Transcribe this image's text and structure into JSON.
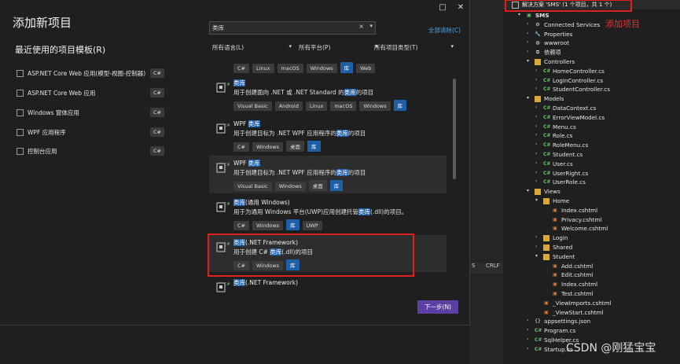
{
  "dialog": {
    "title": "添加新项目",
    "recent_title": "最近使用的项目模板(R)",
    "window_restore": "□",
    "window_close": "✕",
    "recent_templates": [
      {
        "label": "ASP.NET Core Web 应用(模型-视图-控制器)",
        "tag": "C#"
      },
      {
        "label": "ASP.NET Core Web 应用",
        "tag": "C#"
      },
      {
        "label": "Windows 窗体应用",
        "tag": "C#"
      },
      {
        "label": "WPF 应用程序",
        "tag": "C#"
      },
      {
        "label": "控制台应用",
        "tag": "C#"
      }
    ],
    "search": {
      "value": "类库",
      "clear": "×",
      "dropdown": "▾"
    },
    "clear_all": "全部清除(C)",
    "filters": [
      {
        "label": "所有语言(L)",
        "arrow": "▾"
      },
      {
        "label": "所有平台(P)",
        "arrow": "▾"
      },
      {
        "label": "所有项目类型(T)",
        "arrow": "▾"
      }
    ],
    "results": [
      {
        "name_pre": "",
        "name_hl": "",
        "name_post": "",
        "desc_pre": "",
        "desc_hl": "",
        "desc_post": "",
        "chips": [
          "C#",
          "Linux",
          "macOS",
          "Windows",
          "库",
          "Web"
        ]
      },
      {
        "name_pre": "",
        "name_hl": "类库",
        "name_post": "",
        "desc_pre": "用于创建面向 .NET 或 .NET Standard 的",
        "desc_hl": "类库",
        "desc_post": "的项目",
        "chips": [
          "Visual Basic",
          "Android",
          "Linux",
          "macOS",
          "Windows",
          "库"
        ]
      },
      {
        "name_pre": "WPF ",
        "name_hl": "类库",
        "name_post": "",
        "desc_pre": "用于创建目标为 .NET WPF 应用程序的",
        "desc_hl": "类库",
        "desc_post": "的项目",
        "chips": [
          "C#",
          "Windows",
          "桌面",
          "库"
        ]
      },
      {
        "name_pre": "WPF ",
        "name_hl": "类库",
        "name_post": "",
        "desc_pre": "用于创建目标为 .NET WPF 应用程序的",
        "desc_hl": "类库",
        "desc_post": "的项目",
        "chips": [
          "Visual Basic",
          "Windows",
          "桌面",
          "库"
        ]
      },
      {
        "name_pre": "",
        "name_hl": "类库",
        "name_post": "(通用 Windows)",
        "desc_pre": "用于为通用 Windows 平台(UWP)应用创建托管",
        "desc_hl": "类库",
        "desc_post": "(.dll)的项目。",
        "chips": [
          "C#",
          "Windows",
          "库",
          "UWP"
        ]
      },
      {
        "name_pre": "",
        "name_hl": "类库",
        "name_post": "(.NET Framework)",
        "desc_pre": "用于创建 C# ",
        "desc_hl": "类库",
        "desc_post": "(.dll)的项目",
        "chips": [
          "C#",
          "Windows",
          "库"
        ]
      },
      {
        "name_pre": "",
        "name_hl": "类库",
        "name_post": "(.NET Framework)",
        "desc_pre": "",
        "desc_hl": "",
        "desc_post": "",
        "chips": []
      }
    ],
    "next_button": "下一步(N)"
  },
  "background": {
    "status_left": "S",
    "status_right": "CRLF"
  },
  "solution_explorer": {
    "header": "解决方案 'SMS' (1 个项目，共 1 个)",
    "annotation": "添加项目",
    "tree": [
      {
        "label": "SMS",
        "kind": "project",
        "depth": 0,
        "exp": "▾"
      },
      {
        "label": "Connected Services",
        "kind": "service",
        "depth": 1,
        "exp": "›"
      },
      {
        "label": "Properties",
        "kind": "props",
        "depth": 1,
        "exp": "›"
      },
      {
        "label": "wwwroot",
        "kind": "web",
        "depth": 1,
        "exp": "›"
      },
      {
        "label": "依赖项",
        "kind": "deps",
        "depth": 1,
        "exp": "›"
      },
      {
        "label": "Controllers",
        "kind": "folder",
        "depth": 1,
        "exp": "▾"
      },
      {
        "label": "HomeController.cs",
        "kind": "cs",
        "depth": 2,
        "exp": "›"
      },
      {
        "label": "LoginController.cs",
        "kind": "cs",
        "depth": 2,
        "exp": "›"
      },
      {
        "label": "StudentController.cs",
        "kind": "cs",
        "depth": 2,
        "exp": "›"
      },
      {
        "label": "Models",
        "kind": "folder",
        "depth": 1,
        "exp": "▾"
      },
      {
        "label": "DataContext.cs",
        "kind": "cs",
        "depth": 2,
        "exp": "›"
      },
      {
        "label": "ErrorViewModel.cs",
        "kind": "cs",
        "depth": 2,
        "exp": "›"
      },
      {
        "label": "Menu.cs",
        "kind": "cs",
        "depth": 2,
        "exp": "›"
      },
      {
        "label": "Role.cs",
        "kind": "cs",
        "depth": 2,
        "exp": "›"
      },
      {
        "label": "RoleMenu.cs",
        "kind": "cs",
        "depth": 2,
        "exp": "›"
      },
      {
        "label": "Student.cs",
        "kind": "cs",
        "depth": 2,
        "exp": "›"
      },
      {
        "label": "User.cs",
        "kind": "cs",
        "depth": 2,
        "exp": "›"
      },
      {
        "label": "UserRight.cs",
        "kind": "cs",
        "depth": 2,
        "exp": "›"
      },
      {
        "label": "UserRole.cs",
        "kind": "cs",
        "depth": 2,
        "exp": "›"
      },
      {
        "label": "Views",
        "kind": "folder",
        "depth": 1,
        "exp": "▾"
      },
      {
        "label": "Home",
        "kind": "folder",
        "depth": 2,
        "exp": "▾"
      },
      {
        "label": "Index.cshtml",
        "kind": "html",
        "depth": 3,
        "exp": ""
      },
      {
        "label": "Privacy.cshtml",
        "kind": "html",
        "depth": 3,
        "exp": ""
      },
      {
        "label": "Welcome.cshtml",
        "kind": "html",
        "depth": 3,
        "exp": ""
      },
      {
        "label": "Login",
        "kind": "folder",
        "depth": 2,
        "exp": "›"
      },
      {
        "label": "Shared",
        "kind": "folder",
        "depth": 2,
        "exp": "›"
      },
      {
        "label": "Student",
        "kind": "folder",
        "depth": 2,
        "exp": "▾"
      },
      {
        "label": "Add.cshtml",
        "kind": "html",
        "depth": 3,
        "exp": ""
      },
      {
        "label": "Edit.cshtml",
        "kind": "html",
        "depth": 3,
        "exp": ""
      },
      {
        "label": "Index.cshtml",
        "kind": "html",
        "depth": 3,
        "exp": ""
      },
      {
        "label": "Test.cshtml",
        "kind": "html",
        "depth": 3,
        "exp": ""
      },
      {
        "label": "_ViewImports.cshtml",
        "kind": "html",
        "depth": 2,
        "exp": ""
      },
      {
        "label": "_ViewStart.cshtml",
        "kind": "html",
        "depth": 2,
        "exp": ""
      },
      {
        "label": "appsettings.json",
        "kind": "json",
        "depth": 1,
        "exp": "›"
      },
      {
        "label": "Program.cs",
        "kind": "cs",
        "depth": 1,
        "exp": "›"
      },
      {
        "label": "SqlHelper.cs",
        "kind": "cs",
        "depth": 1,
        "exp": "›"
      },
      {
        "label": "Startup.cs",
        "kind": "cs",
        "depth": 1,
        "exp": "›"
      }
    ]
  },
  "watermark": "CSDN @刚猛宝宝",
  "colors": {
    "accent": "#5b3fa3",
    "highlight": "#1f5fa8",
    "annotation_red": "#e02020",
    "folder": "#d9a838",
    "link": "#4ea1e8"
  }
}
